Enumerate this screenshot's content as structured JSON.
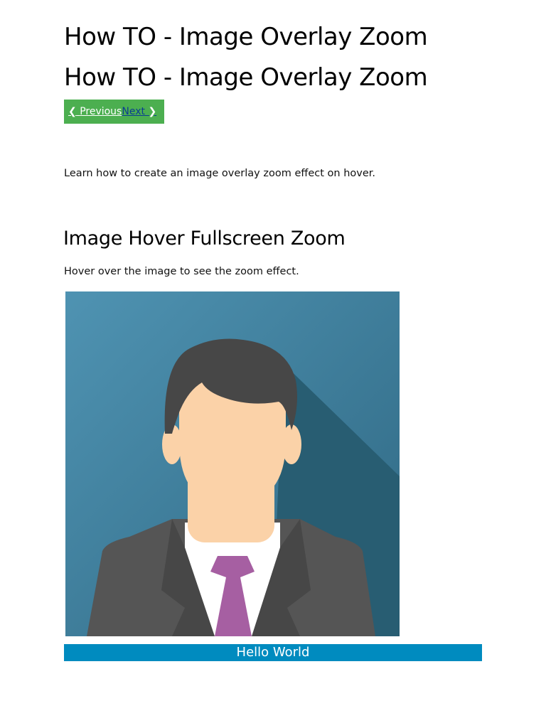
{
  "page": {
    "title_1": "How TO - Image Overlay Zoom",
    "title_2": "How TO - Image Overlay Zoom"
  },
  "nav": {
    "prev_chevron": "❮",
    "prev_label": "Previous",
    "next_label": "Next",
    "next_chevron": "❯"
  },
  "intro_text": "Learn how to create an image overlay zoom effect on hover.",
  "section": {
    "heading": "Image Hover Fullscreen Zoom",
    "hint": "Hover over the image to see the zoom effect."
  },
  "image": {
    "icon": "avatar-icon",
    "overlay_text": "Hello World"
  },
  "colors": {
    "nav_bg": "#4caf50",
    "overlay_bg": "#008bbf",
    "avatar_bg": "#3f7c98",
    "hair": "#474747",
    "skin": "#fbd2a8",
    "suit": "#555555",
    "tie": "#a65fa2"
  }
}
